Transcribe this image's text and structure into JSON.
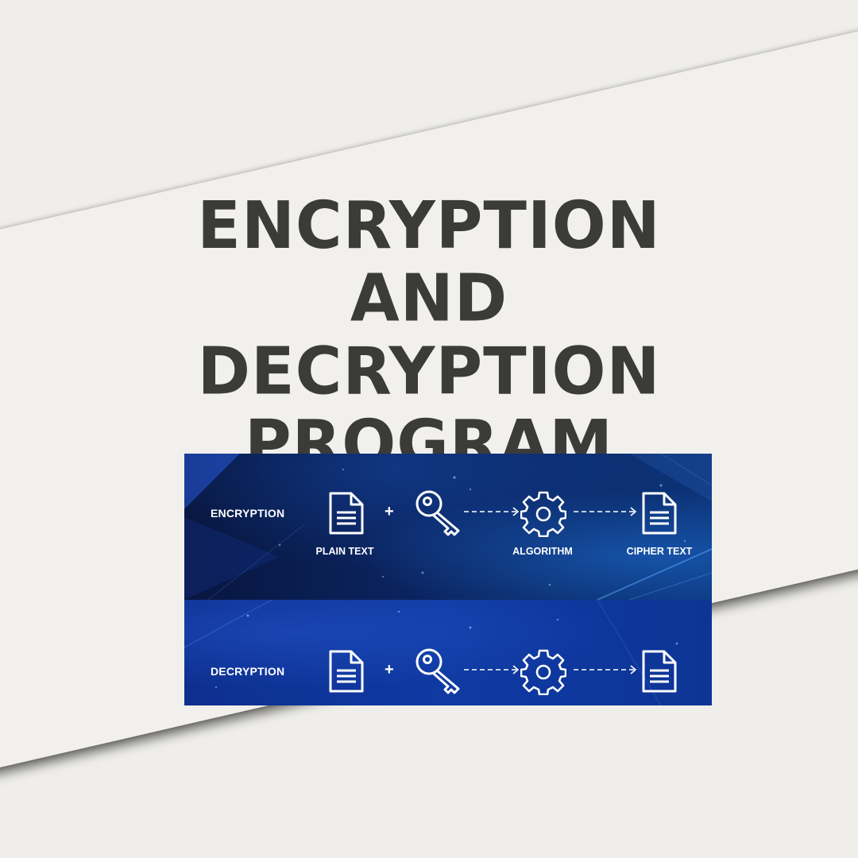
{
  "title": {
    "line1": "ENCRYPTION",
    "line2": "AND",
    "line3": "DECRYPTION",
    "line4": "PROGRAM"
  },
  "diagram": {
    "encryption": {
      "label": "ENCRYPTION",
      "plus": "+",
      "input_caption": "PLAIN TEXT",
      "algorithm_caption": "ALGORITHM",
      "output_caption": "CIPHER TEXT"
    },
    "decryption": {
      "label": "DECRYPTION",
      "plus": "+"
    }
  },
  "colors": {
    "paper": "#f1f0ec",
    "title_text": "#3b3b3a",
    "band_top": "#0b2460",
    "band_bottom": "#0f3aa3",
    "icon_stroke": "#ffffff"
  },
  "icons": [
    "document-icon",
    "key-icon",
    "dashed-arrow-icon",
    "gear-icon"
  ]
}
